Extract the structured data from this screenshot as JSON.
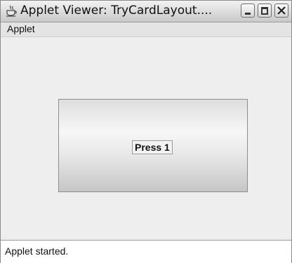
{
  "window": {
    "title": "Applet Viewer: TryCardLayout....",
    "icons": {
      "app": "java-coffee-cup-icon",
      "minimize": "minimize-icon",
      "maximize": "maximize-icon",
      "close": "close-icon"
    }
  },
  "menubar": {
    "items": [
      {
        "label": "Applet"
      }
    ]
  },
  "content": {
    "card_button_label": "Press 1"
  },
  "status": {
    "text": "Applet started."
  }
}
